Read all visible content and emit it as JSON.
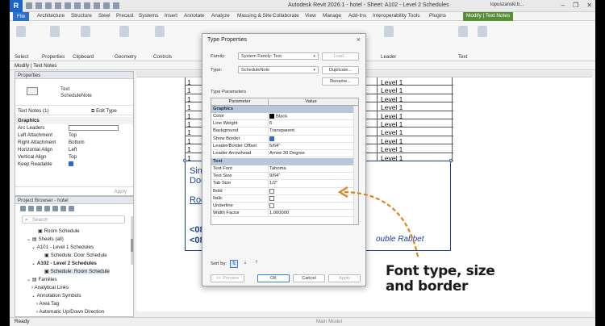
{
  "window": {
    "title": "Autodesk Revit 2026.1 - hotel - Sheet: A102 - Level 2 Schedules",
    "user": "lopuszanski.b..."
  },
  "ribbon_tabs": [
    "File",
    "Architecture",
    "Structure",
    "Steel",
    "Precast",
    "Systems",
    "Insert",
    "Annotate",
    "Analyze",
    "Massing & Site",
    "Collaborate",
    "View",
    "Manage",
    "Add-Ins",
    "Interoperability Tools",
    "Plugins",
    "Modify | Text Notes"
  ],
  "ribbon_panels": [
    "Select",
    "Properties",
    "Clipboard",
    "Geometry",
    "Controls",
    "Leader",
    "Text"
  ],
  "options_bar": "Modify | Text Notes",
  "properties": {
    "header": "Properties",
    "type_name_line1": "Text",
    "type_name_line2": "ScheduleNote",
    "instance_label": "Text Notes (1)",
    "edit_type": "Edit Type",
    "category": "Graphics",
    "rows": [
      {
        "key": "Arc Leaders",
        "value": ""
      },
      {
        "key": "Left Attachment",
        "value": "Top"
      },
      {
        "key": "Right Attachment",
        "value": "Bottom"
      },
      {
        "key": "Horizontal Align",
        "value": "Left"
      },
      {
        "key": "Vertical Align",
        "value": "Top"
      },
      {
        "key": "Keep Readable",
        "value": ""
      }
    ],
    "apply": "Apply"
  },
  "project_browser": {
    "header": "Project Browser - hotel",
    "search_placeholder": "Search",
    "items": [
      "Room Schedule",
      "Sheets (all)",
      "A101 - Level 1 Schedules",
      "Schedule: Door Schedule",
      "A102 - Level 2 Schedules",
      "Schedule: Room Schedule",
      "Families",
      "Analytical Links",
      "Annotation Symbols",
      "Area Tag",
      "Automatic Up/Down Direction"
    ]
  },
  "view": {
    "schedule_rows": [
      {
        "num": "1",
        "level": "Level 1"
      },
      {
        "num": "1",
        "level": "Level 1"
      },
      {
        "num": "1",
        "level": "Level 1"
      },
      {
        "num": "1",
        "level": "Level 1"
      },
      {
        "num": "1",
        "level": "Level 1"
      },
      {
        "num": "1",
        "level": "Level 1"
      },
      {
        "num": "1",
        "level": "Level 1"
      },
      {
        "num": "1",
        "level": "Level 1"
      },
      {
        "num": "1",
        "level": "Level 1"
      },
      {
        "num": "1",
        "level": "Level 1"
      }
    ],
    "notes": [
      "Single-",
      "Double",
      "Rooms",
      "<08 1",
      "<08 1"
    ],
    "rabbet": "ouble Rabbet"
  },
  "status_bar": {
    "status": "Ready",
    "model": "Main Model"
  },
  "dialog": {
    "title": "Type Properties",
    "family_label": "Family:",
    "family_value": "System Family: Text",
    "type_label": "Type:",
    "type_value": "ScheduleNote",
    "load_btn": "Load...",
    "duplicate_btn": "Duplicate...",
    "rename_btn": "Rename...",
    "type_params_label": "Type Parameters",
    "col_parameter": "Parameter",
    "col_value": "Value",
    "graphics_cat": "Graphics",
    "graphics_rows": [
      {
        "key": "Color",
        "value": "Black"
      },
      {
        "key": "Line Weight",
        "value": "6"
      },
      {
        "key": "Background",
        "value": "Transparent"
      },
      {
        "key": "Show Border",
        "value": ""
      },
      {
        "key": "Leader/Border Offset",
        "value": "5/64\""
      },
      {
        "key": "Leader Arrowhead",
        "value": "Arrow 30 Degree"
      }
    ],
    "text_cat": "Text",
    "text_rows": [
      {
        "key": "Text Font",
        "value": "Tahoma"
      },
      {
        "key": "Text Size",
        "value": "9/64\""
      },
      {
        "key": "Tab Size",
        "value": "1/2\""
      },
      {
        "key": "Bold",
        "value": ""
      },
      {
        "key": "Italic",
        "value": ""
      },
      {
        "key": "Underline",
        "value": ""
      },
      {
        "key": "Width Factor",
        "value": "1.000000"
      }
    ],
    "sort_by": "Sort by:",
    "preview_btn": "<< Preview",
    "ok_btn": "OK",
    "cancel_btn": "Cancel",
    "apply_btn": "Apply"
  },
  "annotation": {
    "line1": "Font type, size",
    "line2": "and border",
    "arrow_color": "#e0821e"
  }
}
